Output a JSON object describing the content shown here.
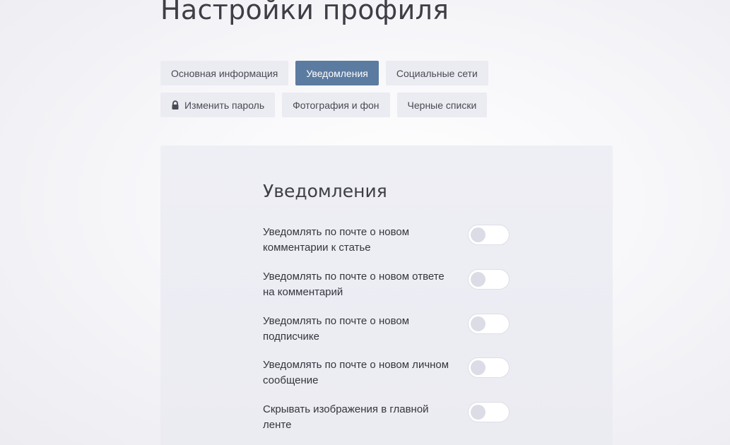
{
  "page": {
    "title": "Настройки профиля"
  },
  "tabs": {
    "row1": [
      {
        "label": "Основная информация",
        "active": false
      },
      {
        "label": "Уведомления",
        "active": true
      },
      {
        "label": "Социальные сети",
        "active": false
      }
    ],
    "row2": [
      {
        "label": "Изменить пароль",
        "icon": "lock-icon",
        "active": false
      },
      {
        "label": "Фотография и фон",
        "active": false
      },
      {
        "label": "Черные списки",
        "active": false
      }
    ]
  },
  "colors": {
    "accent": "#5b7ba1",
    "tab_bg": "#ebebf2",
    "panel_bg": "#ededf4"
  },
  "notifications": {
    "title": "Уведомления",
    "items": [
      {
        "label": "Уведомлять по почте о новом комментарии к статье",
        "enabled": false
      },
      {
        "label": "Уведомлять по почте о новом ответе на комментарий",
        "enabled": false
      },
      {
        "label": "Уведомлять по почте о новом подписчике",
        "enabled": false
      },
      {
        "label": "Уведомлять по почте о новом личном сообщение",
        "enabled": false
      },
      {
        "label": "Скрывать изображения в главной ленте",
        "enabled": false
      }
    ]
  }
}
